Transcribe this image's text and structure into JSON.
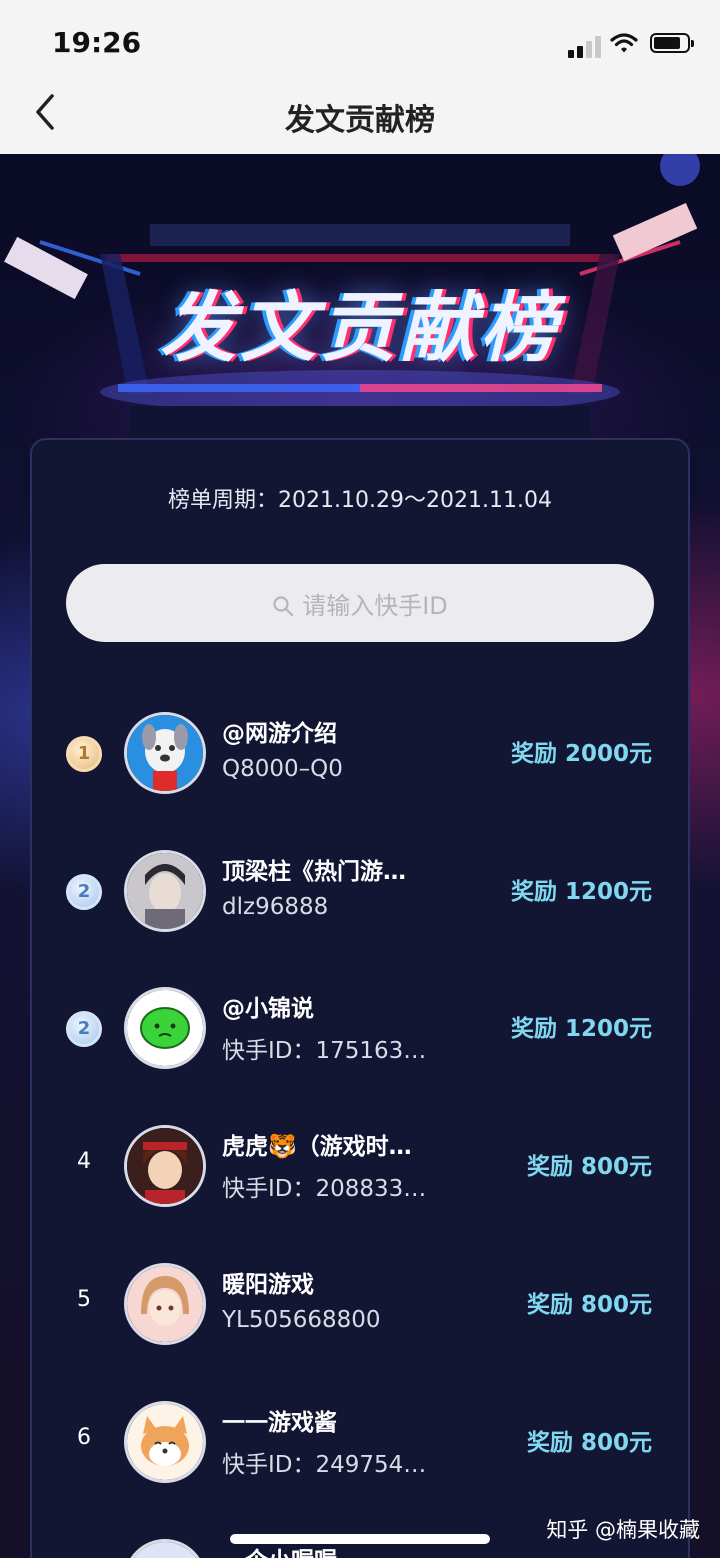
{
  "status_bar": {
    "time": "19:26"
  },
  "nav": {
    "title": "发文贡献榜"
  },
  "banner": {
    "title": "发文贡献榜"
  },
  "card": {
    "period": "榜单周期：2021.10.29～2021.11.04",
    "search_placeholder": "请输入快手ID"
  },
  "rows": [
    {
      "rank": "1",
      "rank_style": "gold",
      "name": "@网游介绍",
      "uid": "Q8000–Q0",
      "reward": "奖励 2000元",
      "avatar": "dog"
    },
    {
      "rank": "2",
      "rank_style": "silver",
      "name": "顶梁柱《热门游…",
      "uid": "dlz96888",
      "reward": "奖励 1200元",
      "avatar": "portrait"
    },
    {
      "rank": "2",
      "rank_style": "silver",
      "name": "@小锦说",
      "uid": "快手ID：175163…",
      "reward": "奖励 1200元",
      "avatar": "green-face"
    },
    {
      "rank": "4",
      "rank_style": "plain",
      "name": "虎虎🐯（游戏时…",
      "uid": "快手ID：208833…",
      "reward": "奖励 800元",
      "avatar": "anime-red"
    },
    {
      "rank": "5",
      "rank_style": "plain",
      "name": "暖阳游戏",
      "uid": "YL505668800",
      "reward": "奖励 800元",
      "avatar": "anime-girl"
    },
    {
      "rank": "6",
      "rank_style": "plain",
      "name": "一一游戏酱",
      "uid": "快手ID：249754…",
      "reward": "奖励 800元",
      "avatar": "shiba"
    },
    {
      "rank": "",
      "rank_style": "plain",
      "name": "一个小喔喔",
      "uid": "",
      "reward": "",
      "avatar": "anime-blue"
    }
  ],
  "watermark": "知乎 @楠果收藏",
  "colors": {
    "reward": "#7fd8f0",
    "card_bg": "#121633",
    "page_bg": "#0c0d2a"
  }
}
